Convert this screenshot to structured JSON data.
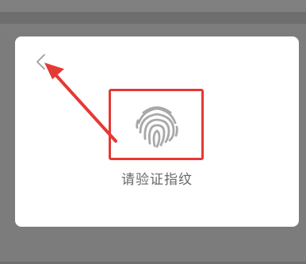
{
  "dialog": {
    "prompt_text": "请验证指纹",
    "back_icon": "chevron-left-icon",
    "fingerprint_icon": "fingerprint-icon"
  },
  "annotations": {
    "highlight_color": "#e53935",
    "arrow_color": "#e53935"
  },
  "colors": {
    "overlay": "#6e6e6e",
    "dialog_bg": "#ffffff",
    "icon_gray": "#a8a8a8",
    "text_gray": "#6a6a6a"
  }
}
